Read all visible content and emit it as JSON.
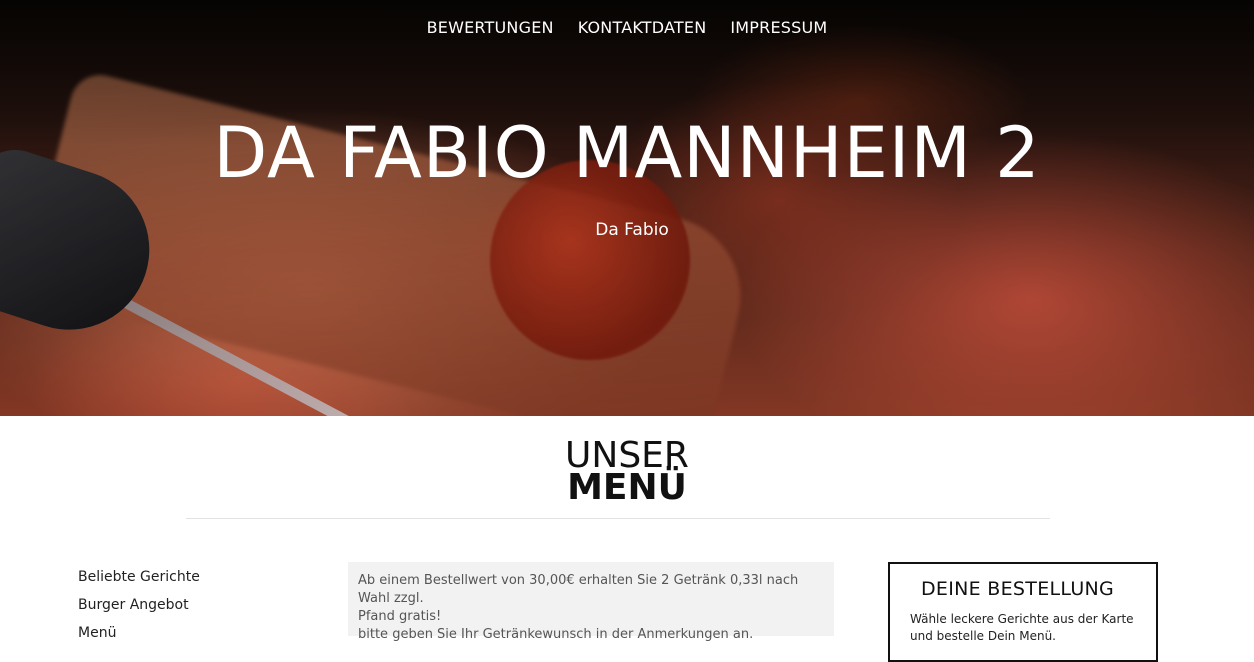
{
  "nav": {
    "items": [
      {
        "label": "BEWERTUNGEN"
      },
      {
        "label": "KONTAKTDATEN"
      },
      {
        "label": "IMPRESSUM"
      }
    ]
  },
  "hero": {
    "title": "DA FABIO MANNHEIM 2",
    "subtitle": "Da Fabio"
  },
  "menu_section": {
    "heading_line1": "UNSER",
    "heading_line2": "MENÜ"
  },
  "categories": [
    {
      "label": "Beliebte Gerichte"
    },
    {
      "label": "Burger Angebot"
    },
    {
      "label": "Menü"
    }
  ],
  "notice": {
    "line1": "Ab einem Bestellwert von 30,00€ erhalten Sie 2 Getränk 0,33l nach Wahl zzgl.",
    "line2": "Pfand gratis!",
    "line3": "bitte geben Sie Ihr Getränkewunsch in der Anmerkungen an."
  },
  "order": {
    "title": "DEINE BESTELLUNG",
    "description": "Wähle leckere Gerichte aus der Karte und bestelle Dein Menü."
  }
}
